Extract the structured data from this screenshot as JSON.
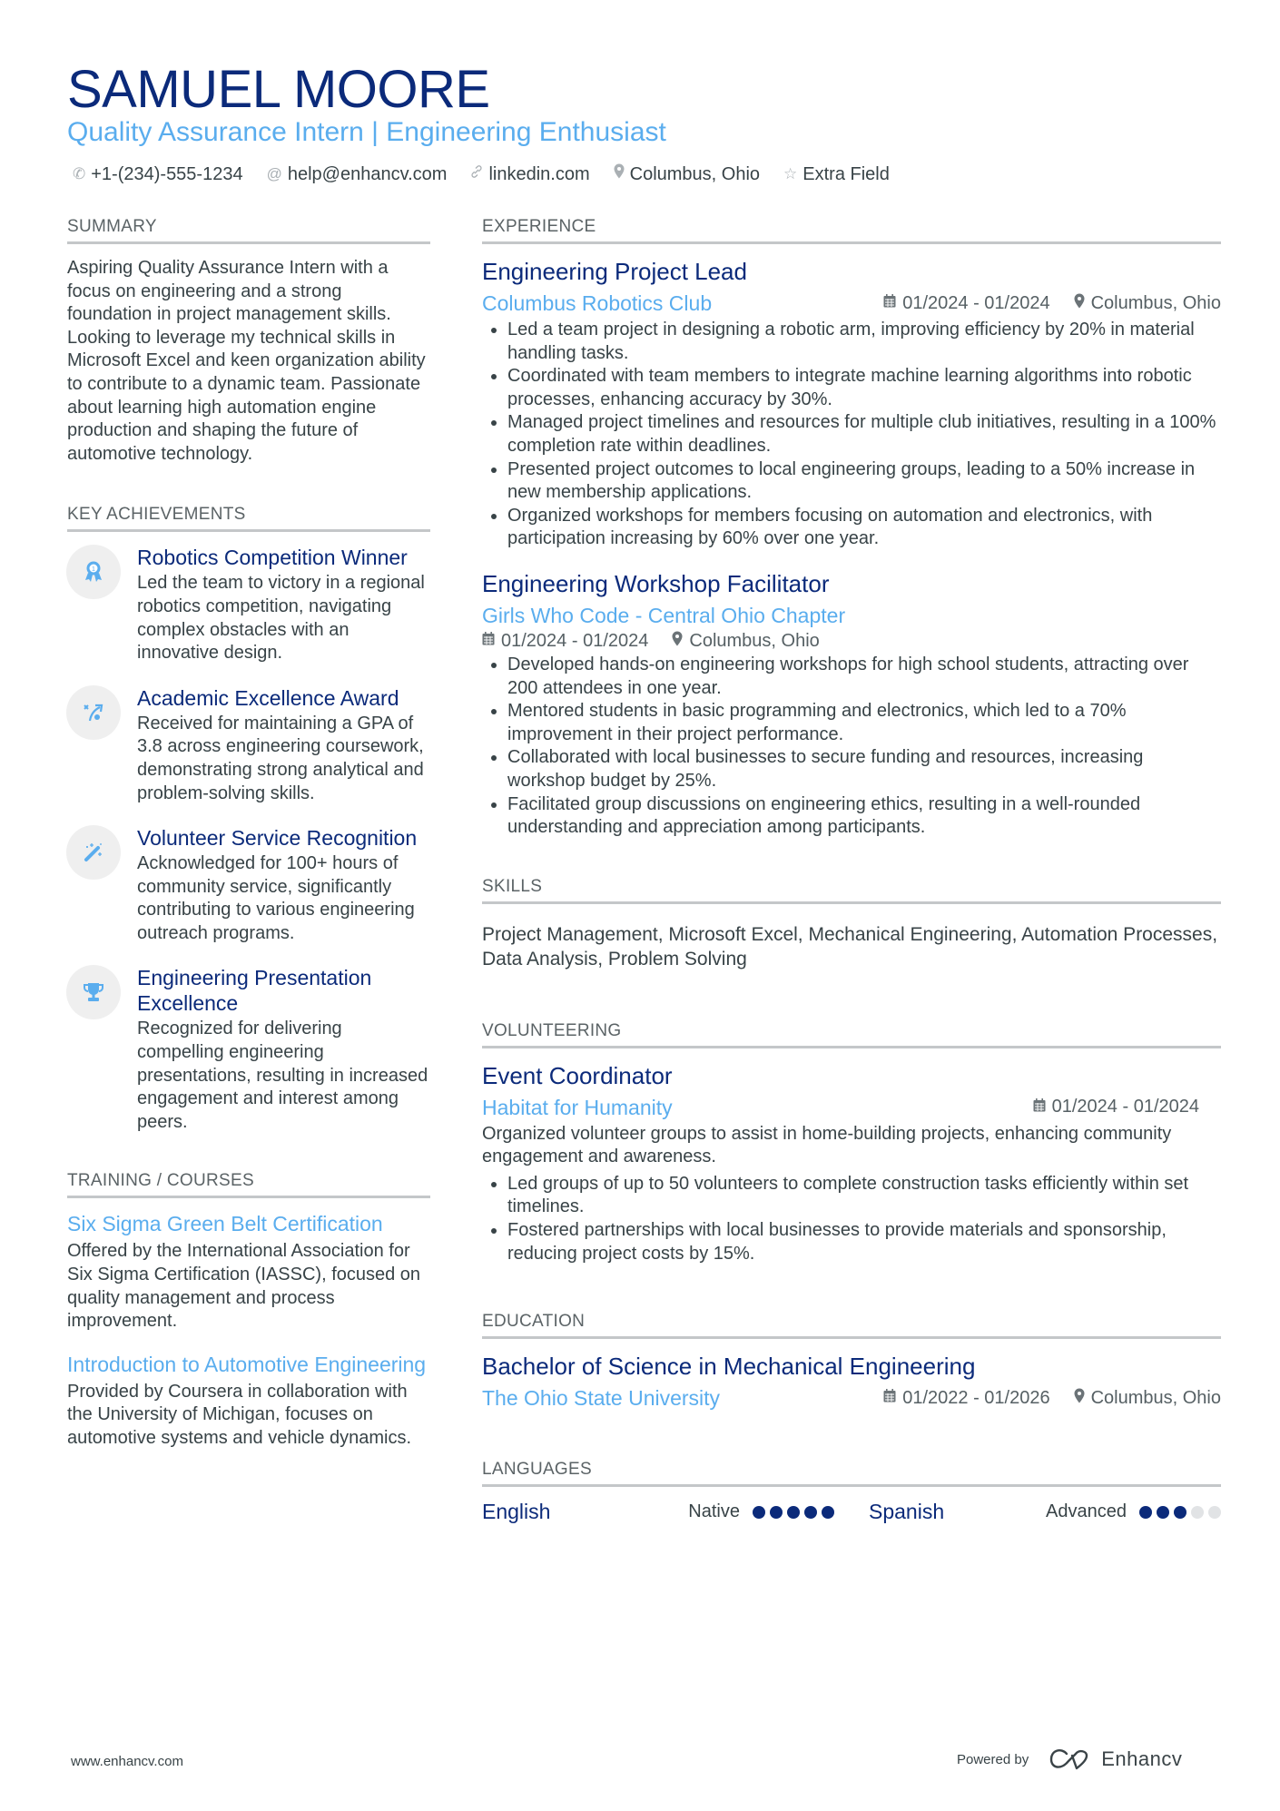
{
  "header": {
    "name": "SAMUEL MOORE",
    "subtitle": "Quality Assurance Intern | Engineering Enthusiast",
    "contacts": [
      {
        "icon": "phone-icon",
        "text": "+1-(234)-555-1234"
      },
      {
        "icon": "at-icon",
        "text": "help@enhancv.com"
      },
      {
        "icon": "link-icon",
        "text": "linkedin.com"
      },
      {
        "icon": "location-pin-icon",
        "text": "Columbus, Ohio"
      },
      {
        "icon": "star-icon",
        "text": "Extra Field"
      }
    ]
  },
  "colors": {
    "primary": "#0b2a7a",
    "accent": "#5aadee",
    "text": "#384347",
    "rule": "#c4c7c9"
  },
  "summary": {
    "heading": "SUMMARY",
    "text": "Aspiring Quality Assurance Intern with a focus on engineering and a strong foundation in project management skills. Looking to leverage my technical skills in Microsoft Excel and keen organization ability to contribute to a dynamic team. Passionate about learning high automation engine production and shaping the future of automotive technology."
  },
  "achievements": {
    "heading": "KEY ACHIEVEMENTS",
    "items": [
      {
        "icon": "award-ribbon-icon",
        "title": "Robotics Competition Winner",
        "text": "Led the team to victory in a regional robotics competition, navigating complex obstacles with an innovative design."
      },
      {
        "icon": "strategy-arrow-icon",
        "title": "Academic Excellence Award",
        "text": "Received for maintaining a GPA of 3.8 across engineering coursework, demonstrating strong analytical and problem-solving skills."
      },
      {
        "icon": "magic-wand-icon",
        "title": "Volunteer Service Recognition",
        "text": "Acknowledged for 100+ hours of community service, significantly contributing to various engineering outreach programs."
      },
      {
        "icon": "trophy-icon",
        "title": "Engineering Presentation Excellence",
        "text": "Recognized for delivering compelling engineering presentations, resulting in increased engagement and interest among peers."
      }
    ]
  },
  "training": {
    "heading": "TRAINING / COURSES",
    "items": [
      {
        "title": "Six Sigma Green Belt Certification",
        "text": "Offered by the International Association for Six Sigma Certification (IASSC), focused on quality management and process improvement."
      },
      {
        "title": "Introduction to Automotive Engineering",
        "text": "Provided by Coursera in collaboration with the University of Michigan, focuses on automotive systems and vehicle dynamics."
      }
    ]
  },
  "experience": {
    "heading": "EXPERIENCE",
    "jobs": [
      {
        "title": "Engineering Project Lead",
        "company": "Columbus Robotics Club",
        "dates": "01/2024 - 01/2024",
        "location": "Columbus, Ohio",
        "bullets": [
          "Led a team project in designing a robotic arm, improving efficiency by 20% in material handling tasks.",
          "Coordinated with team members to integrate machine learning algorithms into robotic processes, enhancing accuracy by 30%.",
          "Managed project timelines and resources for multiple club initiatives, resulting in a 100% completion rate within deadlines.",
          "Presented project outcomes to local engineering groups, leading to a 50% increase in new membership applications.",
          "Organized workshops for members focusing on automation and electronics, with participation increasing by 60% over one year."
        ]
      },
      {
        "title": "Engineering Workshop Facilitator",
        "company": "Girls Who Code - Central Ohio Chapter",
        "dates": "01/2024 - 01/2024",
        "location": "Columbus, Ohio",
        "bullets": [
          "Developed hands-on engineering workshops for high school students, attracting over 200 attendees in one year.",
          "Mentored students in basic programming and electronics, which led to a 70% improvement in their project performance.",
          "Collaborated with local businesses to secure funding and resources, increasing workshop budget by 25%.",
          "Facilitated group discussions on engineering ethics, resulting in a well-rounded understanding and appreciation among participants."
        ]
      }
    ]
  },
  "skills": {
    "heading": "SKILLS",
    "text": "Project Management, Microsoft Excel, Mechanical Engineering, Automation Processes, Data Analysis, Problem Solving"
  },
  "volunteering": {
    "heading": "VOLUNTEERING",
    "title": "Event Coordinator",
    "org": "Habitat for Humanity",
    "dates": "01/2024 - 01/2024",
    "description": "Organized volunteer groups to assist in home-building projects, enhancing community engagement and awareness.",
    "bullets": [
      "Led groups of up to 50 volunteers to complete construction tasks efficiently within set timelines.",
      "Fostered partnerships with local businesses to provide materials and sponsorship, reducing project costs by 15%."
    ]
  },
  "education": {
    "heading": "EDUCATION",
    "degree": "Bachelor of Science in Mechanical Engineering",
    "school": "The Ohio State University",
    "dates": "01/2022 - 01/2026",
    "location": "Columbus, Ohio"
  },
  "languages": {
    "heading": "LANGUAGES",
    "items": [
      {
        "name": "English",
        "level": "Native",
        "rating": 5,
        "max": 5
      },
      {
        "name": "Spanish",
        "level": "Advanced",
        "rating": 3,
        "max": 5
      }
    ]
  },
  "footer": {
    "website": "www.enhancv.com",
    "powered_by": "Powered by",
    "brand": "Enhancv"
  }
}
